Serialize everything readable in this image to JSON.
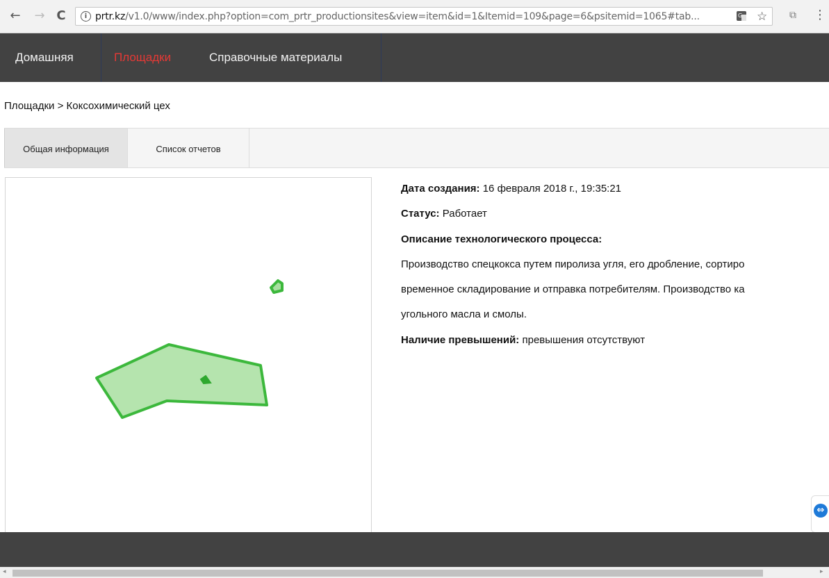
{
  "browser": {
    "back_icon": "←",
    "forward_icon": "→",
    "reload_icon": "C",
    "url_host": "prtr.kz",
    "url_path": "/v1.0/www/index.php?option=com_prtr_productionsites&view=item&id=1&Itemid=109&page=6&psitemid=1065#tab...",
    "translate_icon": "translate-icon",
    "star_icon": "☆",
    "ext_icon": "⧉",
    "menu_icon": "⋮"
  },
  "nav": {
    "items": [
      {
        "label": "Домашняя",
        "active": false
      },
      {
        "label": "Площадки",
        "active": true
      },
      {
        "label": "Справочные материалы",
        "active": false
      }
    ]
  },
  "breadcrumb": "Площадки > Коксохимический цех",
  "tabs": [
    {
      "label": "Общая информация",
      "active": true
    },
    {
      "label": "Список отчетов",
      "active": false
    }
  ],
  "info": {
    "created_label": "Дата создания:",
    "created_value": "16 февраля 2018 г., 19:35:21",
    "status_label": "Статус:",
    "status_value": "Работает",
    "desc_label": "Описание технологического процесса:",
    "desc_line1": "Производство спецкокса путем пиролиза угля, его дробление, сортиро",
    "desc_line2": "временное складирование и отправка потребителям. Производство ка",
    "desc_line3": "угольного масла и смолы.",
    "excess_label": "Наличие превышений:",
    "excess_value": "превышения отсутствуют"
  },
  "colors": {
    "nav_bg": "#424242",
    "nav_active": "#e53935",
    "map_fill": "#a8dfa0",
    "map_stroke": "#3cb83c"
  }
}
